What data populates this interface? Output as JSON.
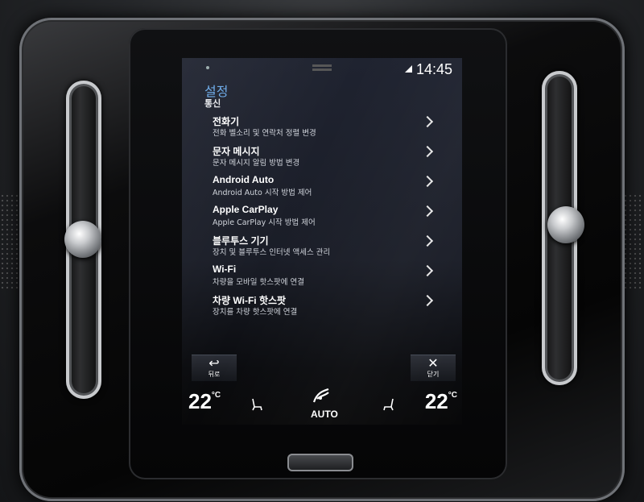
{
  "status": {
    "time": "14:45"
  },
  "header": {
    "title": "설정",
    "subtitle": "통신"
  },
  "menu": [
    {
      "label": "전화기",
      "desc": "전화 벨소리 및 연락처 정렬 변경"
    },
    {
      "label": "문자 메시지",
      "desc": "문자 메시지 알림 방법 변경"
    },
    {
      "label": "Android Auto",
      "desc": "Android Auto 시작 방법 제어"
    },
    {
      "label": "Apple CarPlay",
      "desc": "Apple CarPlay 시작 방법 제어"
    },
    {
      "label": "블루투스 기기",
      "desc": "장치 및 블루투스 인터넷 액세스 관리"
    },
    {
      "label": "Wi-Fi",
      "desc": "차량을 모바일 핫스팟에 연결"
    },
    {
      "label": "차량 Wi-Fi 핫스팟",
      "desc": "장치를 차량 핫스팟에 연결"
    }
  ],
  "nav": {
    "back_label": "뒤로",
    "close_label": "닫기"
  },
  "climate": {
    "left_temp": "22",
    "right_temp": "22",
    "unit": "°C",
    "mode": "AUTO"
  },
  "colors": {
    "accent": "#6aa9e8",
    "text": "#ffffff"
  },
  "icons": {
    "back": "back-arrow-icon",
    "close": "close-icon",
    "seat": "seat-heat-icon",
    "fan": "fan-icon"
  }
}
